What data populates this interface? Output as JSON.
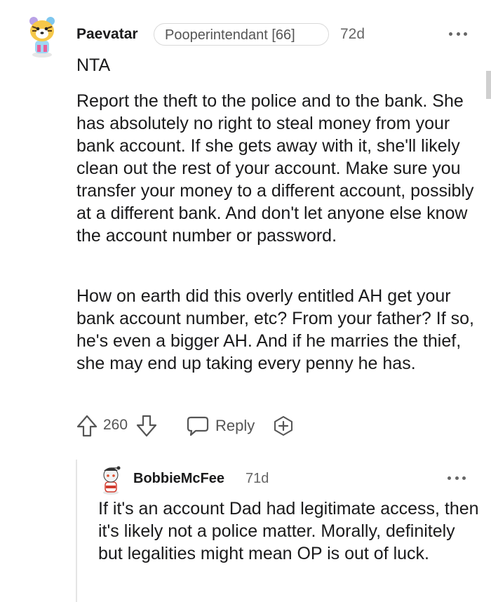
{
  "comment": {
    "username": "Paevatar",
    "flair": "Pooperintendant [66]",
    "time": "72d",
    "paragraphs": [
      "NTA",
      "Report the theft to the police and to the bank. She has absolutely no right to steal money from your bank account. If she gets away with it, she'll likely clean out the rest of your account. Make sure you transfer your money to a different account, possibly at a different bank. And don't let anyone else know the account number or password.",
      "How on earth did this overly entitled AH get your bank account number, etc? From your father? If so, he's even a bigger AH. And if he marries the thief, she may end up taking every penny he has."
    ],
    "votes": "260",
    "reply_label": "Reply"
  },
  "reply": {
    "username": "BobbieMcFee",
    "time": "71d",
    "text": "If it's an account Dad had legitimate access, then it's likely not a police matter. Morally, definitely but legalities might mean OP is out of luck."
  },
  "icons": {
    "upvote": "arrow-up-outline-icon",
    "downvote": "arrow-down-outline-icon",
    "reply": "speech-bubble-icon",
    "award": "plus-award-icon",
    "menu": "horizontal-ellipsis-icon"
  },
  "colors": {
    "text": "#1a1a1b",
    "meta": "#666666",
    "border": "#d9d9d9"
  }
}
